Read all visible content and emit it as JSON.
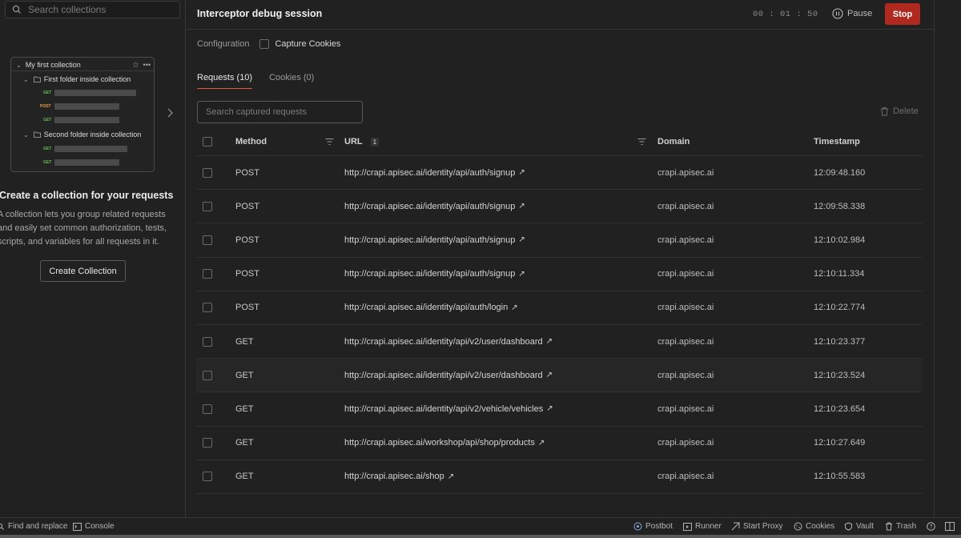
{
  "sidebar": {
    "search_placeholder": "Search collections",
    "illustration": {
      "collection": "My first collection",
      "folder1": "First folder inside collection",
      "folder2": "Second folder inside collection",
      "methods": [
        "GET",
        "POST",
        "GET",
        "GET",
        "GET"
      ]
    },
    "empty_title": "Create a collection for your requests",
    "empty_desc": [
      "A collection lets you group related requests",
      "and easily set common authorization, tests,",
      "scripts, and variables for all requests in it."
    ],
    "create_button": "Create Collection"
  },
  "session": {
    "title": "Interceptor debug session",
    "timer": "00 : 01 : 50",
    "pause_label": "Pause",
    "stop_label": "Stop",
    "config_label": "Configuration",
    "capture_cookies_label": "Capture Cookies",
    "tabs": [
      {
        "label": "Requests (10)"
      },
      {
        "label": "Cookies (0)"
      }
    ],
    "search_placeholder": "Search captured requests",
    "delete_label": "Delete"
  },
  "table": {
    "headers": {
      "method": "Method",
      "url": "URL",
      "url_badge": "1",
      "domain": "Domain",
      "timestamp": "Timestamp"
    },
    "rows": [
      {
        "method": "POST",
        "url": "http://crapi.apisec.ai/identity/api/auth/signup",
        "domain": "crapi.apisec.ai",
        "timestamp": "12:09:48.160"
      },
      {
        "method": "POST",
        "url": "http://crapi.apisec.ai/identity/api/auth/signup",
        "domain": "crapi.apisec.ai",
        "timestamp": "12:09:58.338"
      },
      {
        "method": "POST",
        "url": "http://crapi.apisec.ai/identity/api/auth/signup",
        "domain": "crapi.apisec.ai",
        "timestamp": "12:10:02.984"
      },
      {
        "method": "POST",
        "url": "http://crapi.apisec.ai/identity/api/auth/signup",
        "domain": "crapi.apisec.ai",
        "timestamp": "12:10:11.334"
      },
      {
        "method": "POST",
        "url": "http://crapi.apisec.ai/identity/api/auth/login",
        "domain": "crapi.apisec.ai",
        "timestamp": "12:10:22.774"
      },
      {
        "method": "GET",
        "url": "http://crapi.apisec.ai/identity/api/v2/user/dashboard",
        "domain": "crapi.apisec.ai",
        "timestamp": "12:10:23.377"
      },
      {
        "method": "GET",
        "url": "http://crapi.apisec.ai/identity/api/v2/user/dashboard",
        "domain": "crapi.apisec.ai",
        "timestamp": "12:10:23.524"
      },
      {
        "method": "GET",
        "url": "http://crapi.apisec.ai/identity/api/v2/vehicle/vehicles",
        "domain": "crapi.apisec.ai",
        "timestamp": "12:10:23.654"
      },
      {
        "method": "GET",
        "url": "http://crapi.apisec.ai/workshop/api/shop/products",
        "domain": "crapi.apisec.ai",
        "timestamp": "12:10:27.649"
      },
      {
        "method": "GET",
        "url": "http://crapi.apisec.ai/shop",
        "domain": "crapi.apisec.ai",
        "timestamp": "12:10:55.583"
      }
    ]
  },
  "footer": {
    "find_replace": "Find and replace",
    "console": "Console",
    "postbot": "Postbot",
    "runner": "Runner",
    "start_proxy": "Start Proxy",
    "cookies": "Cookies",
    "vault": "Vault",
    "trash": "Trash"
  },
  "colors": {
    "accent": "#e2563c",
    "stop": "#b0291f",
    "get": "#6bbf59",
    "post": "#e0a53b"
  }
}
